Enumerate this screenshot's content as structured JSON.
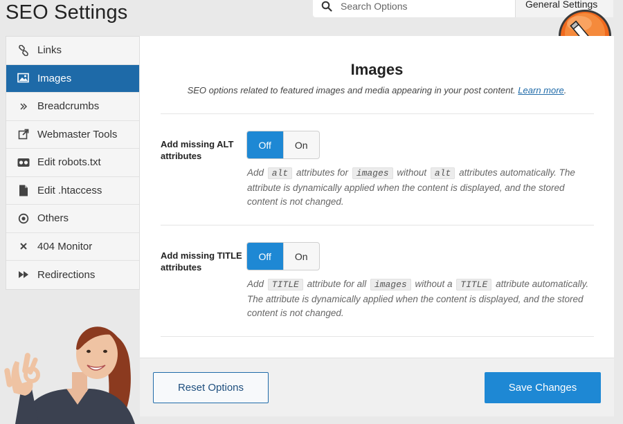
{
  "header": {
    "title": "SEO Settings",
    "search_placeholder": "Search Options",
    "settings_tab": "General Settings"
  },
  "sidebar": {
    "items": [
      {
        "label": "Links",
        "icon": "link-icon",
        "active": false
      },
      {
        "label": "Images",
        "icon": "image-icon",
        "active": true
      },
      {
        "label": "Breadcrumbs",
        "icon": "double-chevron-icon",
        "active": false
      },
      {
        "label": "Webmaster Tools",
        "icon": "external-link-icon",
        "active": false
      },
      {
        "label": "Edit robots.txt",
        "icon": "robot-icon",
        "active": false
      },
      {
        "label": "Edit .htaccess",
        "icon": "file-icon",
        "active": false
      },
      {
        "label": "Others",
        "icon": "circle-dot-icon",
        "active": false
      },
      {
        "label": "404 Monitor",
        "icon": "x-icon",
        "active": false
      },
      {
        "label": "Redirections",
        "icon": "fast-forward-icon",
        "active": false
      }
    ]
  },
  "main": {
    "title": "Images",
    "subtitle": "SEO options related to featured images and media appearing in your post content.",
    "learn_more": "Learn more",
    "options": [
      {
        "label": "Add missing ALT attributes",
        "off": "Off",
        "on": "On",
        "selected": "Off",
        "desc": {
          "t1": "Add",
          "c1": "alt",
          "t2": "attributes for",
          "c2": "images",
          "t3": "without",
          "c3": "alt",
          "t4": "attributes automatically. The attribute is dynamically applied when the content is displayed, and the stored content is not changed."
        }
      },
      {
        "label": "Add missing TITLE attributes",
        "off": "Off",
        "on": "On",
        "selected": "Off",
        "desc": {
          "t1": "Add",
          "c1": "TITLE",
          "t2": "attribute for all",
          "c2": "images",
          "t3": "without a",
          "c3": "TITLE",
          "t4": "attribute automatically. The attribute is dynamically applied when the content is displayed, and the stored content is not changed."
        }
      }
    ]
  },
  "footer": {
    "reset": "Reset Options",
    "save": "Save Changes"
  },
  "colors": {
    "accent": "#1e88d4",
    "active_nav": "#1e6aa8",
    "badge_orange": "#f06a1e"
  }
}
